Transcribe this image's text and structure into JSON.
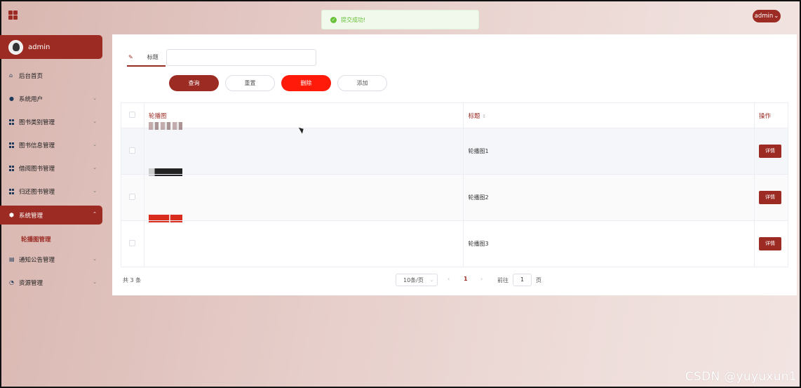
{
  "header": {
    "toast": "提交成功!",
    "user": "admin"
  },
  "sidebar": {
    "username": "admin",
    "items": [
      {
        "label": "后台首页",
        "icon": "home-icon"
      },
      {
        "label": "系统用户",
        "icon": "user-icon"
      },
      {
        "label": "图书类别管理",
        "icon": "grid-icon"
      },
      {
        "label": "图书信息管理",
        "icon": "grid-icon"
      },
      {
        "label": "借阅图书管理",
        "icon": "grid-icon"
      },
      {
        "label": "归还图书管理",
        "icon": "grid-icon"
      },
      {
        "label": "系统管理",
        "icon": "settings-icon"
      },
      {
        "label": "通知公告管理",
        "icon": "notice-icon"
      },
      {
        "label": "资源管理",
        "icon": "pie-icon"
      }
    ],
    "submenu_active": "轮播图管理"
  },
  "search": {
    "label": "标题",
    "value": ""
  },
  "buttons": {
    "query": "查询",
    "reset": "重置",
    "delete": "删除",
    "add": "添加"
  },
  "table": {
    "headers": [
      "轮播图",
      "标题",
      "操作"
    ],
    "rows": [
      {
        "title": "轮播图1",
        "action": "详情"
      },
      {
        "title": "轮播图2",
        "action": "详情"
      },
      {
        "title": "轮播图3",
        "action": "详情"
      }
    ]
  },
  "pagination": {
    "total": "共 3 条",
    "page_size": "10条/页",
    "current_page": "1",
    "goto_label": "前往",
    "goto_value": "1",
    "page_suffix": "页"
  },
  "watermark": "CSDN @yuyuxun1",
  "colors": {
    "accent": "#9b2b23",
    "danger": "#ff1a0a",
    "success": "#67c23a"
  }
}
